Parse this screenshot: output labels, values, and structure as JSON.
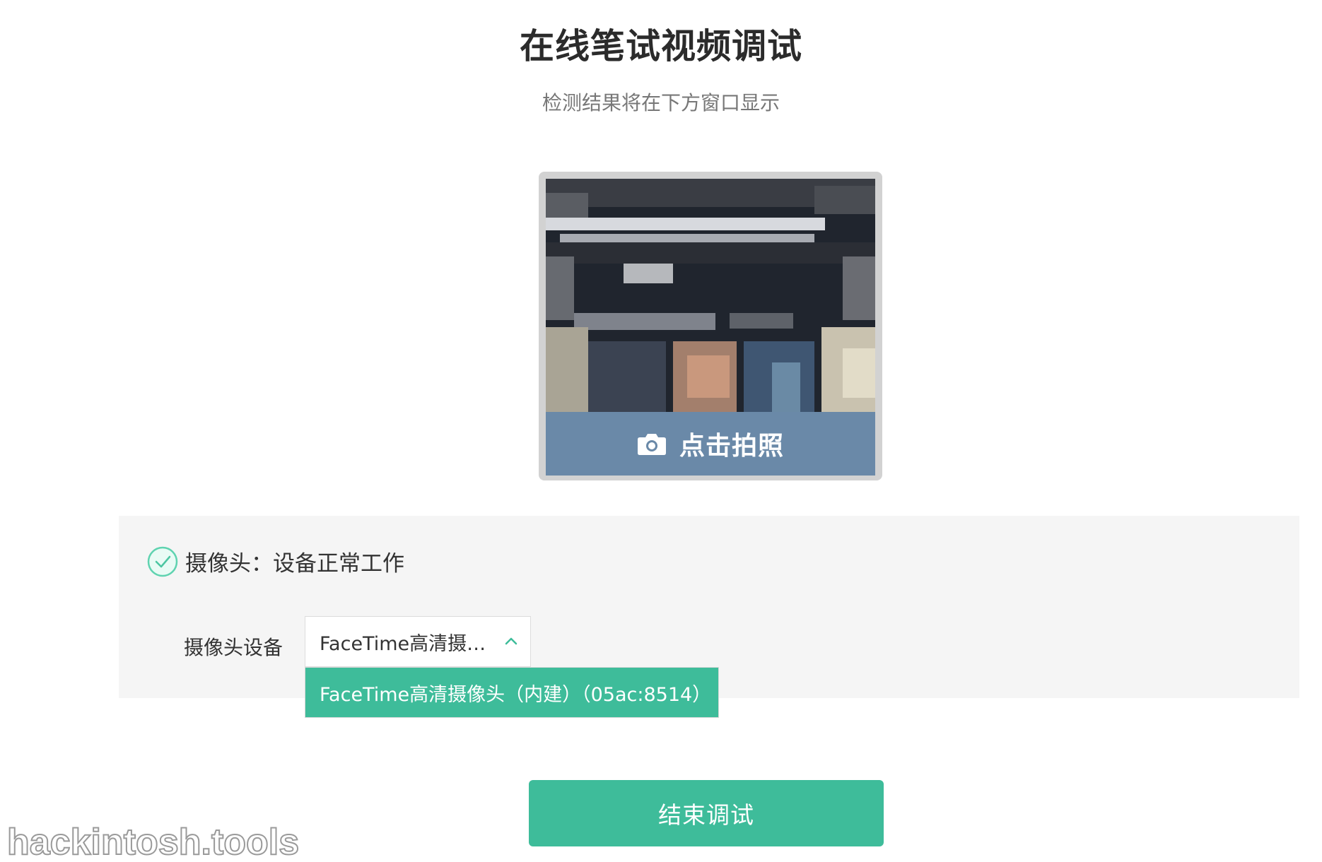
{
  "page": {
    "title": "在线笔试视频调试",
    "subtitle": "检测结果将在下方窗口显示"
  },
  "preview": {
    "snap_label": "点击拍照",
    "camera_icon": "camera-icon"
  },
  "camera_status": {
    "icon": "check-circle-icon",
    "text": "摄像头：设备正常工作"
  },
  "device_select": {
    "label": "摄像头设备",
    "selected_value": "FaceTime高清摄像头（内建）（05ac:8514）",
    "options": [
      "FaceTime高清摄像头（内建）（05ac:8514）"
    ],
    "chevron_icon": "chevron-up-icon",
    "expanded": true
  },
  "actions": {
    "end_label": "结束调试"
  },
  "watermark": {
    "text": "hackintosh.tools"
  },
  "colors": {
    "accent": "#3ebc9a",
    "snap_bar": "#6a89a8",
    "panel_bg": "#f5f5f5"
  }
}
